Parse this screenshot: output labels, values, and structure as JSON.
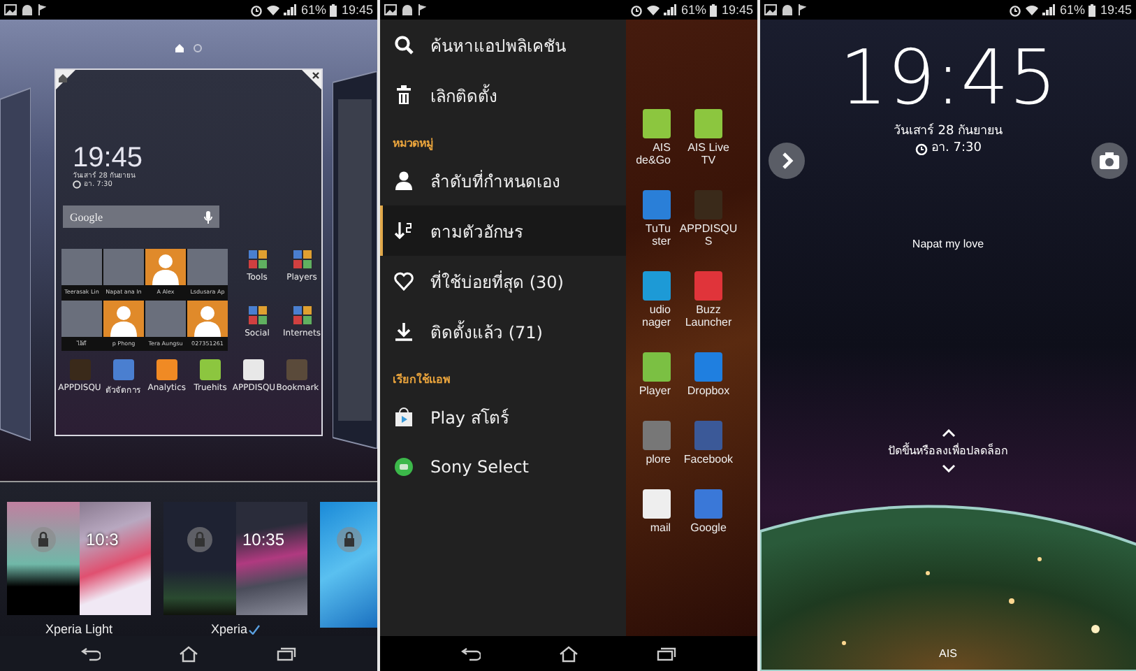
{
  "home_editor": {
    "status_bar": {
      "battery": "61%",
      "time": "19:45"
    },
    "page_indicator": [
      {
        "kind": "home",
        "selected": true
      },
      {
        "kind": "dot",
        "selected": false
      }
    ],
    "card": {
      "clock": "19:45",
      "date": "วันเสาร์ 28 กันยายน",
      "alarm": "อา. 7:30",
      "search_label": "Google",
      "contacts": [
        {
          "name": "Teerasak Lin",
          "kind": "photo"
        },
        {
          "name": "Napat ana In",
          "kind": "photo"
        },
        {
          "name": "A Alex",
          "kind": "silhouette"
        },
        {
          "name": "Lsdusara Ap",
          "kind": "photo"
        },
        {
          "name": "ไอ้ดี",
          "kind": "photo"
        },
        {
          "name": "p Phong",
          "kind": "silhouette"
        },
        {
          "name": "Tera Aungsu",
          "kind": "photo"
        },
        {
          "name": "027351261",
          "kind": "silhouette"
        }
      ],
      "folders": [
        {
          "label": "Tools"
        },
        {
          "label": "Players"
        },
        {
          "label": "Social"
        },
        {
          "label": "Internets"
        }
      ],
      "dock": [
        {
          "label": "APPDISQU",
          "color": "#3a2a1a"
        },
        {
          "label": "ตัวจัดการ",
          "color": "#4a7fd0"
        },
        {
          "label": "Analytics",
          "color": "#f08a24"
        },
        {
          "label": "Truehits",
          "color": "#8cc63f"
        },
        {
          "label": "APPDISQU",
          "color": "#e8e8e8"
        },
        {
          "label": "Bookmark",
          "color": "#5a4a3a"
        }
      ]
    },
    "themes": [
      {
        "name": "Xperia Light",
        "time": "10:3",
        "selected": false
      },
      {
        "name": "Xperia",
        "time": "10:35",
        "selected": true
      }
    ]
  },
  "app_drawer": {
    "status_bar": {
      "battery": "61%",
      "time": "19:45"
    },
    "menu": [
      {
        "kind": "item",
        "label": "ค้นหาแอปพลิเคชัน",
        "selected": false
      },
      {
        "kind": "item",
        "label": "เลิกติดตั้ง",
        "selected": false
      },
      {
        "kind": "header",
        "label": "หมวดหมู่"
      },
      {
        "kind": "item",
        "label": "ลำดับที่กำหนดเอง",
        "selected": false
      },
      {
        "kind": "item",
        "label": "ตามตัวอักษร",
        "selected": true
      },
      {
        "kind": "item",
        "label": "ที่ใช้บ่อยที่สุด (30)",
        "selected": false
      },
      {
        "kind": "item",
        "label": "ติดตั้งแล้ว (71)",
        "selected": false
      },
      {
        "kind": "header",
        "label": "เรียกใช้แอพ"
      },
      {
        "kind": "item",
        "label": "Play สโตร์",
        "selected": false
      },
      {
        "kind": "item",
        "label": "Sony Select",
        "selected": false
      }
    ],
    "apps": [
      {
        "label": "AIS\nde&Go",
        "color": "#8cc63f"
      },
      {
        "label": "AIS Live\nTV",
        "color": "#8cc63f"
      },
      {
        "label": "TuTu\nster",
        "color": "#2a7fd8"
      },
      {
        "label": "APPDISQU\nS",
        "color": "#3a2a1a"
      },
      {
        "label": "udio\nnager",
        "color": "#1d9ad6"
      },
      {
        "label": "Buzz\nLauncher",
        "color": "#e0343a"
      },
      {
        "label": "Player",
        "color": "#7bc043"
      },
      {
        "label": "Dropbox",
        "color": "#1f7fe0"
      },
      {
        "label": "plore",
        "color": "#777777"
      },
      {
        "label": "Facebook",
        "color": "#3b5998"
      },
      {
        "label": "mail",
        "color": "#eeeeee"
      },
      {
        "label": "Google",
        "color": "#3a78d8"
      }
    ]
  },
  "lock_screen": {
    "status_bar": {
      "battery": "61%",
      "time": "19:45"
    },
    "clock": "19:45",
    "date": "วันเสาร์ 28 กันยายน",
    "alarm": "อา. 7:30",
    "owner_message": "Napat my love",
    "unlock_hint": "ปัดขึ้นหรือลงเพื่อปลดล็อก",
    "carrier": "AIS"
  }
}
